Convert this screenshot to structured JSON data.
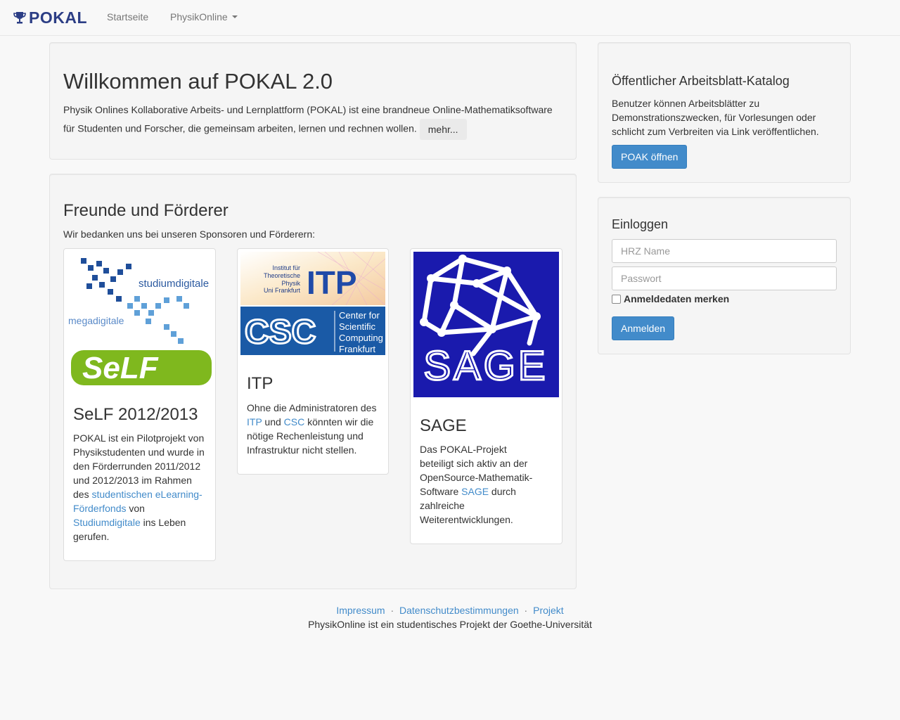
{
  "navbar": {
    "brand": "POKAL",
    "home": "Startseite",
    "physikonline": "PhysikOnline"
  },
  "welcome": {
    "title": "Willkommen auf POKAL 2.0",
    "text": "Physik Onlines Kollaborative Arbeits- und Lernplattform (POKAL) ist eine brandneue Online-Mathematiksoftware für Studenten und Forscher, die gemeinsam arbeiten, lernen und rechnen wollen.",
    "more_button": "mehr..."
  },
  "friends": {
    "title": "Freunde und Förderer",
    "intro": "Wir bedanken uns bei unseren Sponsoren und Förderern:",
    "self": {
      "logo_top_text_1": "studiumdigitale",
      "logo_top_text_2": "megadigitale",
      "logo_bottom_text": "SeLF",
      "title": "SeLF 2012/2013",
      "text_1": "POKAL ist ein Pilotprojekt von Physikstudenten und wurde in den Förderrunden 2011/2012 und 2012/2013 im Rahmen des ",
      "link_1": "studentischen eLearning-Förderfonds",
      "text_2": " von ",
      "link_2": "Studiumdigitale",
      "text_3": " ins Leben gerufen."
    },
    "itp": {
      "logo_institute_1": "Institut für",
      "logo_institute_2": "Theoretische",
      "logo_institute_3": "Physik",
      "logo_institute_4": "Uni Frankfurt",
      "logo_itp": "ITP",
      "logo_csc": "CSC",
      "logo_csc_1": "Center for",
      "logo_csc_2": "Scientific",
      "logo_csc_3": "Computing",
      "logo_csc_4": "Frankfurt",
      "title": "ITP",
      "text_1": "Ohne die Administratoren des ",
      "link_itp": "ITP",
      "text_2": " und ",
      "link_csc": "CSC",
      "text_3": " könnten wir die nötige Rechenleistung und Infrastruktur nicht stellen."
    },
    "sage": {
      "logo_text": "SAGE",
      "title": "SAGE",
      "text_1": "Das POKAL-Projekt beteiligt sich aktiv an der OpenSource-Mathematik-Software ",
      "link": "SAGE",
      "text_2": " durch zahlreiche Weiterentwicklungen."
    }
  },
  "catalog": {
    "title": "Öffentlicher Arbeitsblatt-Katalog",
    "text": "Benutzer können Arbeitsblätter zu Demonstrationszwecken, für Vorlesungen oder schlicht zum Verbreiten via Link veröffentlichen.",
    "button": "POAK öffnen"
  },
  "login": {
    "title": "Einloggen",
    "username_placeholder": "HRZ Name",
    "password_placeholder": "Passwort",
    "remember_label": "Anmeldedaten merken",
    "button": "Anmelden"
  },
  "footer": {
    "impressum": "Impressum",
    "datenschutz": "Datenschutzbestimmungen",
    "projekt": "Projekt",
    "separator": "·",
    "note": "PhysikOnline ist ein studentisches Projekt der Goethe-Universität"
  },
  "colors": {
    "link": "#428bca",
    "primary_button": "#428bca",
    "brand": "#2c3e85",
    "self_green": "#7fb81e",
    "sage_blue": "#1a1aad",
    "csc_blue": "#1a5aa6"
  }
}
